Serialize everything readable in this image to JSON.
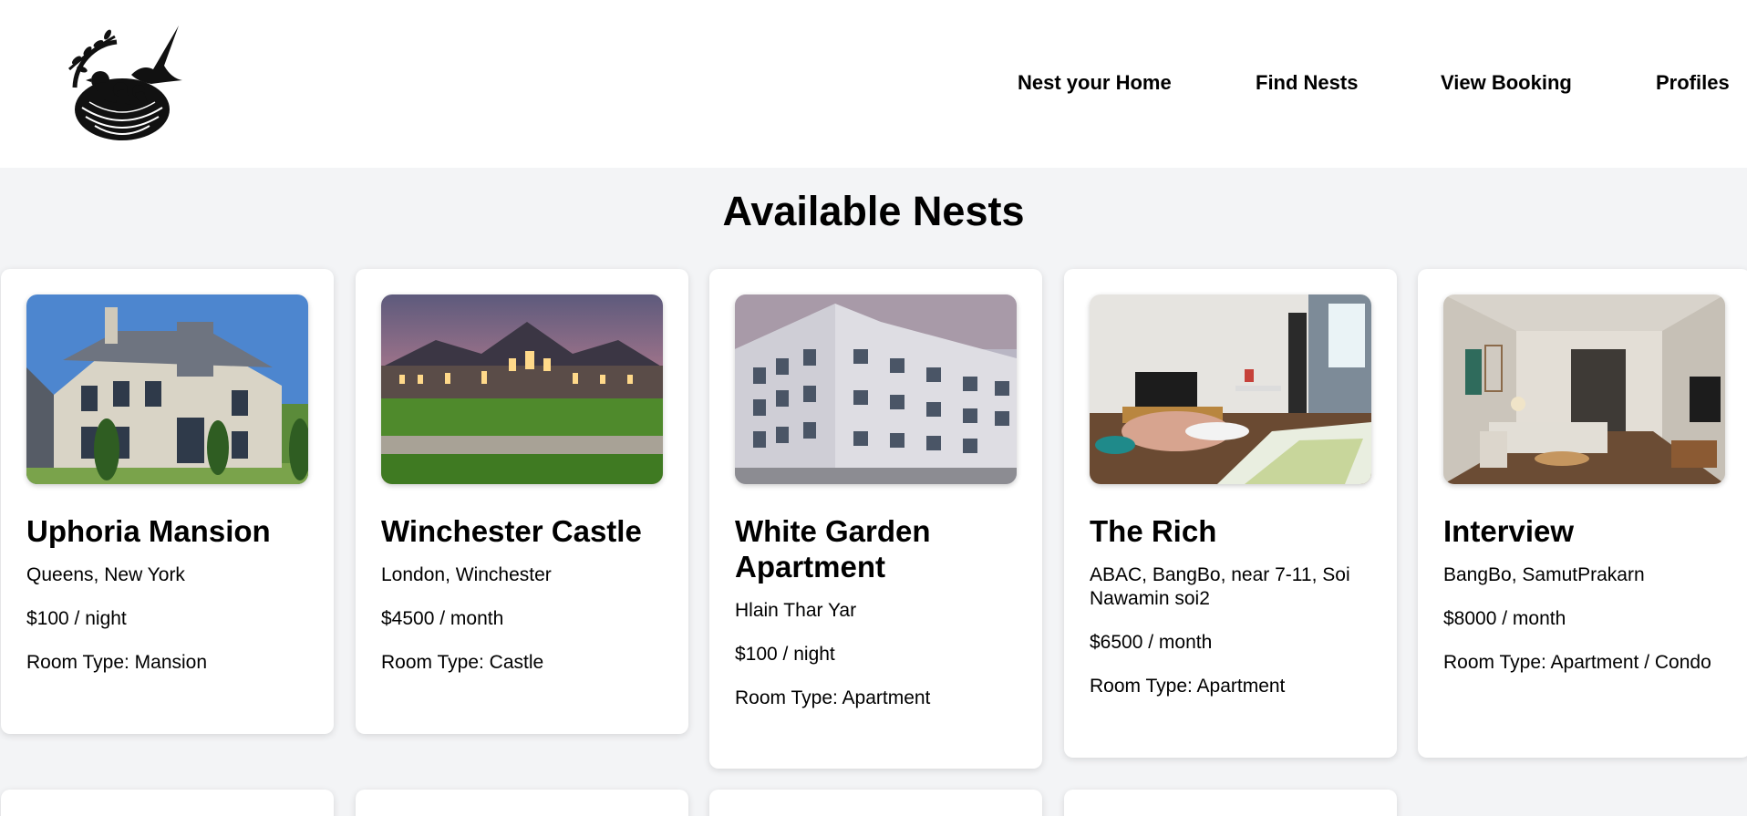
{
  "header": {
    "logo_icon": "bird-nest-logo-icon",
    "nav": [
      {
        "label": "Nest your Home"
      },
      {
        "label": "Find Nests"
      },
      {
        "label": "View Booking"
      },
      {
        "label": "Profiles"
      }
    ]
  },
  "main": {
    "title": "Available Nests",
    "listings": [
      {
        "name": "Uphoria Mansion",
        "location": "Queens, New York",
        "price": "$100 / night",
        "room_type": "Room Type: Mansion",
        "image": "mansion-photo"
      },
      {
        "name": "Winchester Castle",
        "location": "London, Winchester",
        "price": "$4500 / month",
        "room_type": "Room Type: Castle",
        "image": "castle-photo"
      },
      {
        "name": "White Garden Apartment",
        "location": "Hlain Thar Yar",
        "price": "$100 / night",
        "room_type": "Room Type: Apartment",
        "image": "apartment-building-photo"
      },
      {
        "name": "The Rich",
        "location": "ABAC, BangBo, near 7-11, Soi Nawamin soi2",
        "price": "$6500 / month",
        "room_type": "Room Type: Apartment",
        "image": "living-room-photo"
      },
      {
        "name": "Interview",
        "location": "BangBo, SamutPrakarn",
        "price": "$8000 / month",
        "room_type": "Room Type: Apartment / Condo",
        "image": "condo-interior-photo"
      }
    ]
  },
  "colors": {
    "page_background": "#f3f4f6",
    "card_background": "#ffffff",
    "text": "#000000"
  }
}
